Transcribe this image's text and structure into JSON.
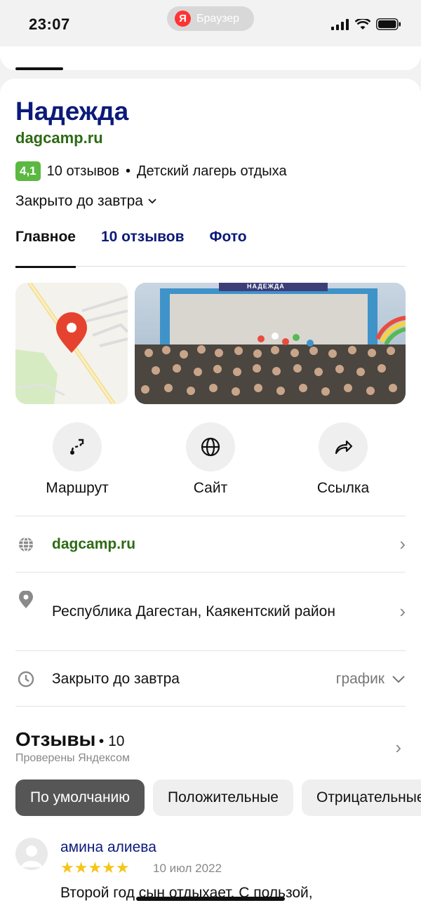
{
  "status_bar": {
    "time": "23:07",
    "browser_label": "Браузер",
    "browser_logo": "Я"
  },
  "place": {
    "title": "Надежда",
    "site": "dagcamp.ru",
    "rating": "4,1",
    "reviews_count_label": "10 отзывов",
    "separator": "•",
    "category": "Детский лагерь отдыха",
    "hours_status": "Закрыто до завтра"
  },
  "tabs": [
    {
      "label": "Главное",
      "active": true
    },
    {
      "label": "10 отзывов",
      "active": false
    },
    {
      "label": "Фото",
      "active": false
    }
  ],
  "photo_banner_text": "НАДЕЖДА",
  "actions": [
    {
      "label": "Маршрут",
      "icon": "route-icon"
    },
    {
      "label": "Сайт",
      "icon": "globe-icon"
    },
    {
      "label": "Ссылка",
      "icon": "share-icon"
    }
  ],
  "info": {
    "website": "dagcamp.ru",
    "address": "Республика Дагестан, Каякентский район",
    "hours": "Закрыто до завтра",
    "schedule_label": "график"
  },
  "reviews": {
    "title": "Отзывы",
    "count": "• 10",
    "subtitle": "Проверены Яндексом",
    "filters": [
      "По умолчанию",
      "Положительные",
      "Отрицательные"
    ],
    "items": [
      {
        "author": "амина алиева",
        "rating": 5,
        "stars": "★★★★★",
        "date": "10 июл 2022",
        "text": "Второй год сын отдыхает. С пользой,"
      }
    ]
  },
  "colors": {
    "title": "#0c1a7a",
    "site": "#2d6a14",
    "rating_badge": "#5bb840",
    "stars": "#f5c518",
    "map_pin": "#e5432f"
  }
}
